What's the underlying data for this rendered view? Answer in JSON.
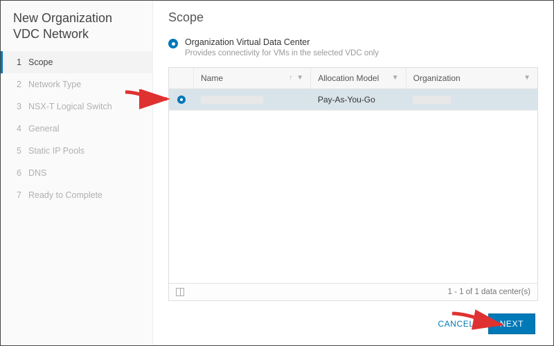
{
  "sidebar": {
    "title": "New Organization VDC Network",
    "steps": [
      {
        "num": "1",
        "label": "Scope",
        "active": true
      },
      {
        "num": "2",
        "label": "Network Type"
      },
      {
        "num": "3",
        "label": "NSX-T Logical Switch"
      },
      {
        "num": "4",
        "label": "General"
      },
      {
        "num": "5",
        "label": "Static IP Pools"
      },
      {
        "num": "6",
        "label": "DNS"
      },
      {
        "num": "7",
        "label": "Ready to Complete"
      }
    ]
  },
  "main": {
    "title": "Scope",
    "option": {
      "label": "Organization Virtual Data Center",
      "description": "Provides connectivity for VMs in the selected VDC only"
    },
    "table": {
      "columns": {
        "name": "Name",
        "allocation": "Allocation Model",
        "organization": "Organization"
      },
      "rows": [
        {
          "name": "",
          "allocation": "Pay-As-You-Go",
          "organization": ""
        }
      ],
      "footer_text": "1 - 1 of 1 data center(s)"
    }
  },
  "footer": {
    "cancel": "CANCEL",
    "next": "NEXT"
  },
  "colors": {
    "accent": "#0079b8"
  }
}
